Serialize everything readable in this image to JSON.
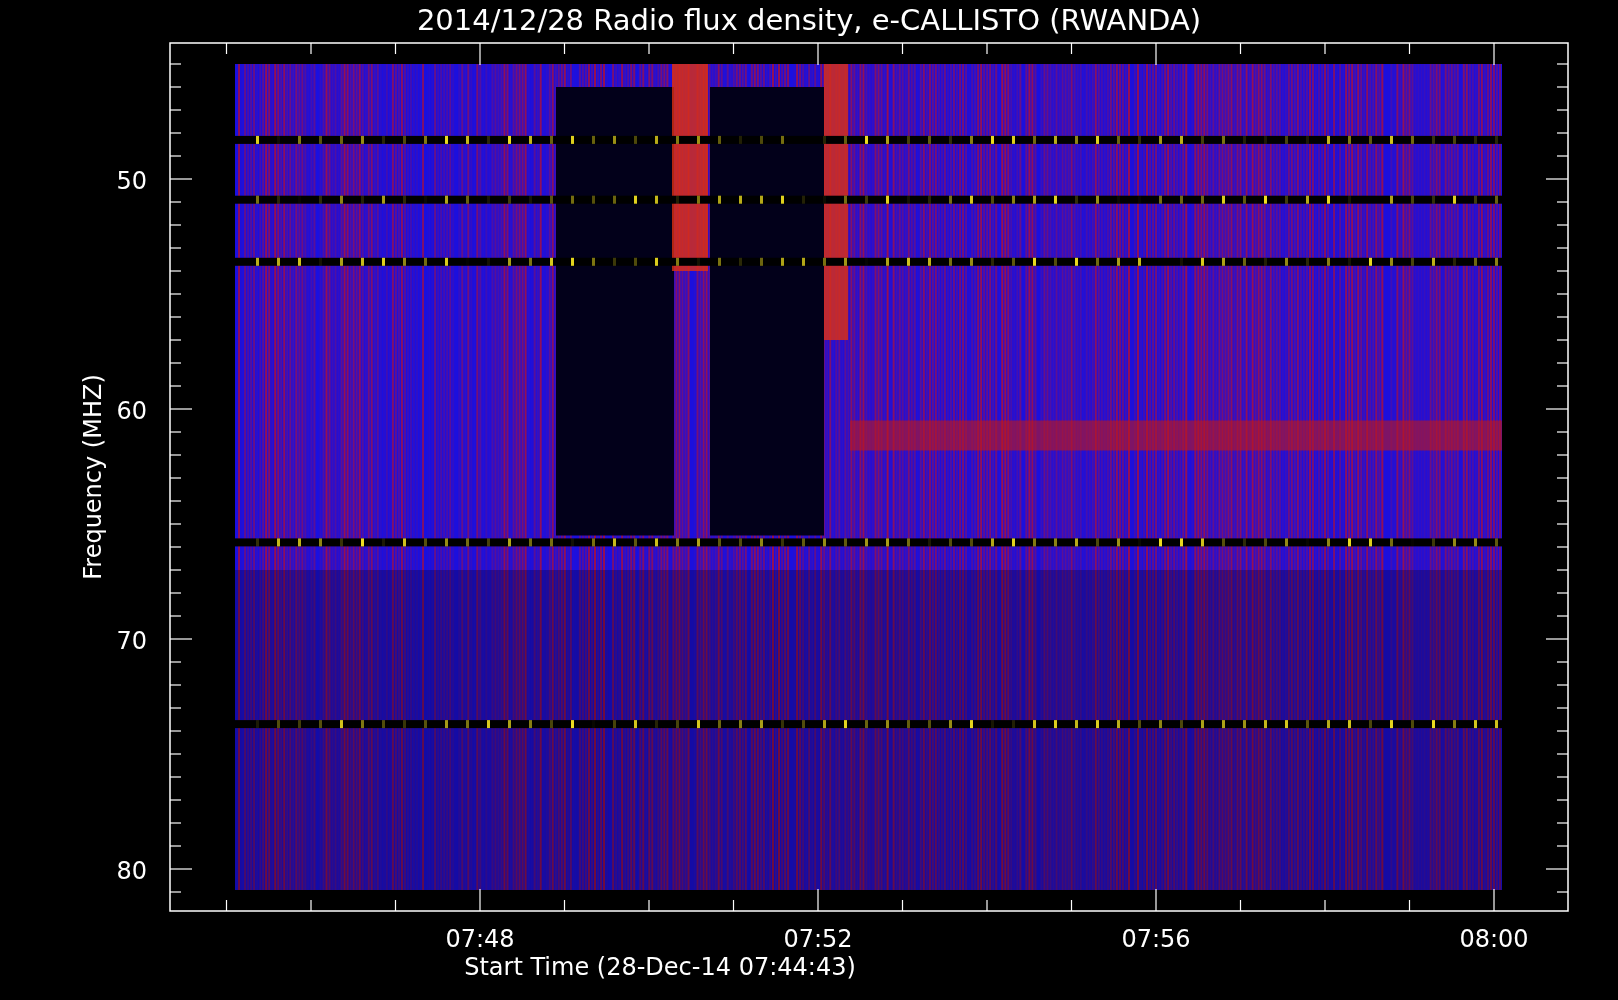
{
  "title": "2014/12/28  Radio flux density, e-CALLISTO (RWANDA)",
  "y_axis": {
    "label": "Frequency (MHZ)",
    "tick_labels": [
      "50",
      "60",
      "70",
      "80"
    ]
  },
  "x_axis": {
    "label": "Start Time (28-Dec-14 07:44:43)",
    "tick_labels": [
      "07:48",
      "07:52",
      "07:56",
      "08:00"
    ]
  }
}
